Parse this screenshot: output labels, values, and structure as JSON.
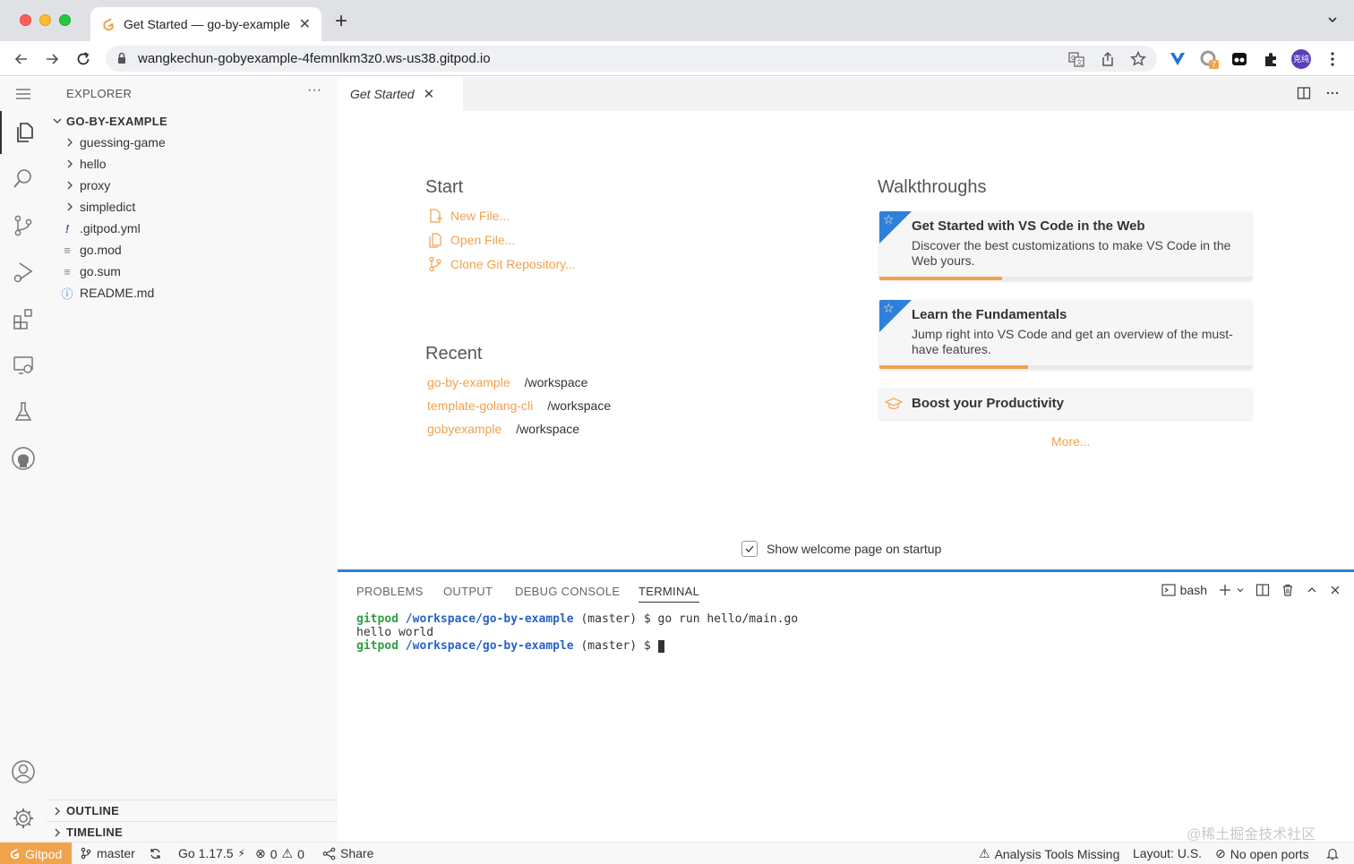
{
  "browser": {
    "tab_title": "Get Started — go-by-example",
    "new_tab": "+",
    "url": "wangkechun-gobyexample-4femnlkm3z0.ws-us38.gitpod.io",
    "profile_initials": "克纯",
    "extension_badge": "7"
  },
  "sidebar": {
    "header": "EXPLORER",
    "more": "···",
    "root": "GO-BY-EXAMPLE",
    "items": [
      {
        "label": "guessing-game",
        "type": "folder"
      },
      {
        "label": "hello",
        "type": "folder"
      },
      {
        "label": "proxy",
        "type": "folder"
      },
      {
        "label": "simpledict",
        "type": "folder"
      },
      {
        "label": ".gitpod.yml",
        "type": "yaml",
        "glyph": "!"
      },
      {
        "label": "go.mod",
        "type": "file",
        "glyph": "≡"
      },
      {
        "label": "go.sum",
        "type": "file",
        "glyph": "≡"
      },
      {
        "label": "README.md",
        "type": "info",
        "glyph": "ⓘ"
      }
    ],
    "outline": "OUTLINE",
    "timeline": "TIMELINE"
  },
  "editor": {
    "tab_title": "Get Started"
  },
  "welcome": {
    "start_title": "Start",
    "start_links": [
      {
        "label": "New File...",
        "icon": "new-file-icon"
      },
      {
        "label": "Open File...",
        "icon": "open-file-icon"
      },
      {
        "label": "Clone Git Repository...",
        "icon": "git-branch-icon"
      }
    ],
    "recent_title": "Recent",
    "recent": [
      {
        "name": "go-by-example",
        "path": "/workspace"
      },
      {
        "name": "template-golang-cli",
        "path": "/workspace"
      },
      {
        "name": "gobyexample",
        "path": "/workspace"
      }
    ],
    "walkthroughs_title": "Walkthroughs",
    "walkthroughs": [
      {
        "title": "Get Started with VS Code in the Web",
        "desc": "Discover the best customizations to make VS Code in the Web yours."
      },
      {
        "title": "Learn the Fundamentals",
        "desc": "Jump right into VS Code and get an overview of the must-have features."
      },
      {
        "title": "Boost your Productivity"
      }
    ],
    "walkthrough_progress": [
      0.33,
      0.4
    ],
    "more": "More...",
    "show_on_startup": "Show welcome page on startup",
    "show_on_startup_checked": true
  },
  "panel": {
    "tabs": [
      "PROBLEMS",
      "OUTPUT",
      "DEBUG CONSOLE",
      "TERMINAL"
    ],
    "active_tab": "TERMINAL",
    "shell": "bash",
    "terminal": {
      "line1_user": "gitpod",
      "line1_path": "/workspace/go-by-example",
      "line1_rest": " (master) $ go run hello/main.go",
      "line2": "hello world",
      "line3_user": "gitpod",
      "line3_path": "/workspace/go-by-example",
      "line3_rest": " (master) $ "
    }
  },
  "statusbar": {
    "gitpod": "Gitpod",
    "branch": "master",
    "go_version": "Go 1.17.5",
    "errors": "0",
    "warnings": "0",
    "share": "Share",
    "analysis": "Analysis Tools Missing",
    "layout": "Layout: U.S.",
    "ports": "No open ports"
  },
  "watermark": "@稀土掘金技术社区",
  "colors": {
    "accent": "#f0a24d",
    "panel_border": "#2f80d8",
    "terminal_user": "#2ea043",
    "terminal_path": "#2763c9"
  }
}
